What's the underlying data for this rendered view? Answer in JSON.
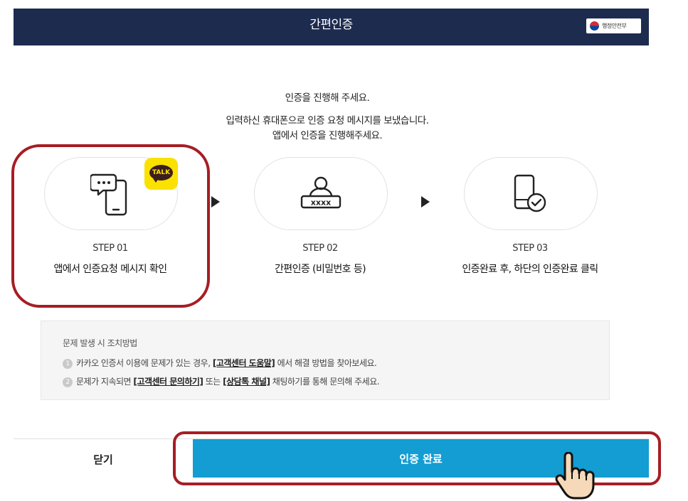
{
  "header": {
    "title": "간편인증",
    "gov_logo_text": "행정안전부"
  },
  "intro": {
    "line1": "인증을 진행해 주세요.",
    "line2": "입력하신 휴대폰으로 인증 요청 메시지를 보냈습니다.",
    "line3": "앱에서 인증을 진행해주세요."
  },
  "steps": [
    {
      "number": "STEP 01",
      "description": "앱에서 인증요청 메시지 확인",
      "icon": "chat-phone-icon",
      "badge": "TALK"
    },
    {
      "number": "STEP 02",
      "description": "간편인증 (비밀번호 등)",
      "icon": "user-password-icon",
      "badge_text": "xxxx"
    },
    {
      "number": "STEP 03",
      "description": "인증완료 후, 하단의 인증완료 클릭",
      "icon": "phone-check-icon"
    }
  ],
  "help": {
    "title": "문제 발생 시 조치방법",
    "item1": {
      "num": "1",
      "prefix": "카카오 인증서 이용에 문제가 있는 경우, ",
      "link": "[고객센터 도움말]",
      "suffix": " 에서 해결 방법을 찾아보세요."
    },
    "item2": {
      "num": "2",
      "prefix": "문제가 지속되면 ",
      "link1": "[고객센터 문의하기]",
      "middle": " 또는 ",
      "link2": "[상담톡 채널]",
      "suffix": " 채팅하기를 통해 문의해 주세요."
    }
  },
  "footer": {
    "close_label": "닫기",
    "confirm_label": "인증 완료"
  },
  "colors": {
    "header_bg": "#1d2b4f",
    "confirm_bg": "#139dd3",
    "highlight": "#a61d24",
    "kakao_yellow": "#fae100"
  }
}
